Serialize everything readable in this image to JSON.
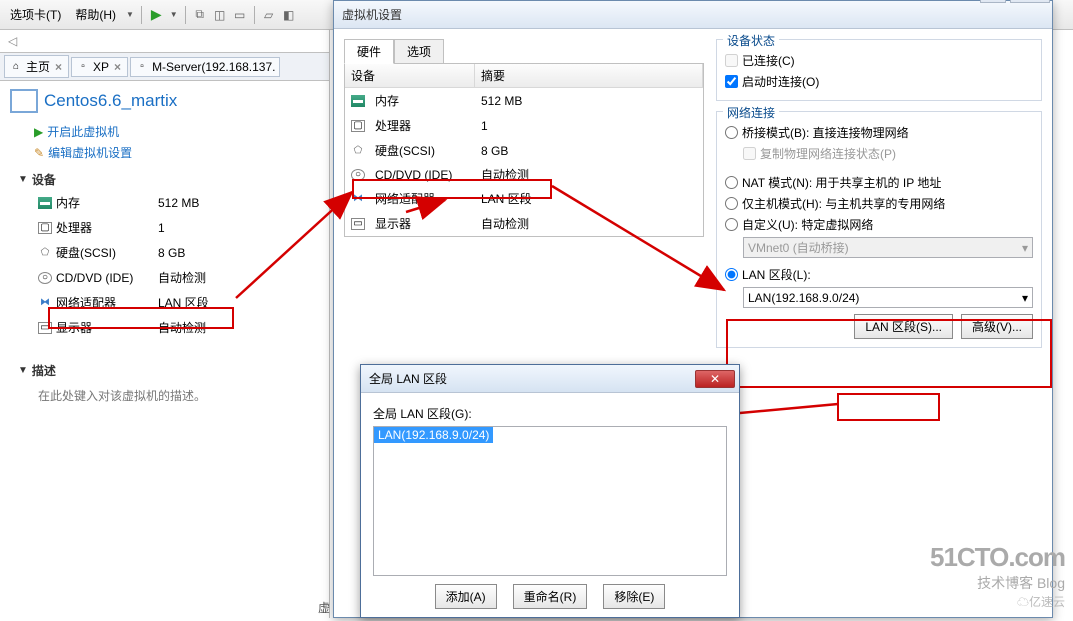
{
  "toolbar": {
    "tabs_menu": "选项卡(T)",
    "help_menu": "帮助(H)"
  },
  "tabs": {
    "home": "主页",
    "xp": "XP",
    "mserver": "M-Server(192.168.137."
  },
  "vm": {
    "title": "Centos6.6_martix",
    "start": "开启此虚拟机",
    "edit": "编辑虚拟机设置"
  },
  "left_section": {
    "devices_hdr": "设备",
    "memory": "内存",
    "memory_val": "512 MB",
    "cpu": "处理器",
    "cpu_val": "1",
    "disk": "硬盘(SCSI)",
    "disk_val": "8 GB",
    "cd": "CD/DVD (IDE)",
    "cd_val": "自动检测",
    "net": "网络适配器",
    "net_val": "LAN 区段",
    "mon": "显示器",
    "mon_val": "自动检测",
    "desc_hdr": "描述",
    "desc_text": "在此处键入对该虚拟机的描述。"
  },
  "settings_dlg": {
    "title": "虚拟机设置",
    "tab_hw": "硬件",
    "tab_opt": "选项",
    "col_device": "设备",
    "col_summary": "摘要",
    "devs": {
      "memory": "内存",
      "memory_val": "512 MB",
      "cpu": "处理器",
      "cpu_val": "1",
      "disk": "硬盘(SCSI)",
      "disk_val": "8 GB",
      "cd": "CD/DVD (IDE)",
      "cd_val": "自动检测",
      "net": "网络适配器",
      "net_val": "LAN 区段",
      "mon": "显示器",
      "mon_val": "自动检测"
    },
    "state_group": "设备状态",
    "chk_connected": "已连接(C)",
    "chk_onstart": "启动时连接(O)",
    "net_group": "网络连接",
    "rdo_bridge": "桥接模式(B): 直接连接物理网络",
    "chk_copy": "复制物理网络连接状态(P)",
    "rdo_nat": "NAT 模式(N): 用于共享主机的 IP 地址",
    "rdo_host": "仅主机模式(H): 与主机共享的专用网络",
    "rdo_custom": "自定义(U): 特定虚拟网络",
    "combo_vmnet": "VMnet0 (自动桥接)",
    "rdo_lan": "LAN 区段(L):",
    "combo_lan": "LAN(192.168.9.0/24)",
    "btn_lan": "LAN 区段(S)...",
    "btn_adv": "高级(V)..."
  },
  "lan_dlg": {
    "title": "全局 LAN 区段",
    "label": "全局 LAN 区段(G):",
    "selected": "LAN(192.168.9.0/24)",
    "btn_add": "添加(A)",
    "btn_rename": "重命名(R)",
    "btn_remove": "移除(E)"
  },
  "watermark": {
    "l1": "51CTO.com",
    "l2": "技术博客    Blog",
    "l3": "亿速云"
  },
  "bottom": "虚"
}
